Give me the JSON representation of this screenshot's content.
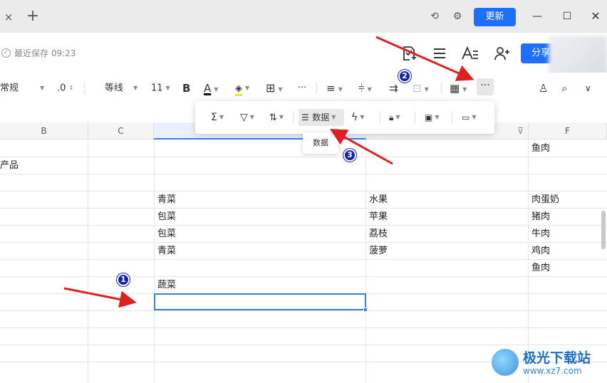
{
  "tabbar": {
    "close": "×",
    "add": "+",
    "update_label": "更新",
    "win_min": "—",
    "win_max": "☐",
    "win_close": "✕"
  },
  "header": {
    "save_status": "最近保存 09:23",
    "share_label": "分享"
  },
  "toolbar": {
    "style": "常规",
    "decimal": ".0",
    "font": "等线",
    "font_size": "11",
    "bold": "B",
    "font_color": "A",
    "more": "···"
  },
  "popup": {
    "data_label": "数据",
    "tooltip": "数据"
  },
  "markers": [
    "1",
    "2",
    "3"
  ],
  "grid": {
    "columns": [
      "B",
      "C",
      "",
      "",
      "F"
    ],
    "rows": [
      {
        "F": "鱼肉"
      },
      {
        "B": "产品"
      },
      {},
      {
        "D": "青菜",
        "E": "水果",
        "F": "肉蛋奶"
      },
      {
        "D": "包菜",
        "E": "苹果",
        "F": "猪肉"
      },
      {
        "D": "包菜",
        "E": "荔枝",
        "F": "牛肉"
      },
      {
        "D": "青菜",
        "E": "菠萝",
        "F": "鸡肉"
      },
      {
        "F": "鱼肉"
      },
      {
        "D": "蔬菜"
      }
    ]
  },
  "watermark": {
    "title": "极光下载站",
    "url": "www.xz7.com"
  },
  "colors": {
    "accent": "#1f6fff",
    "arrow": "#e02020",
    "marker": "#1424a8"
  }
}
